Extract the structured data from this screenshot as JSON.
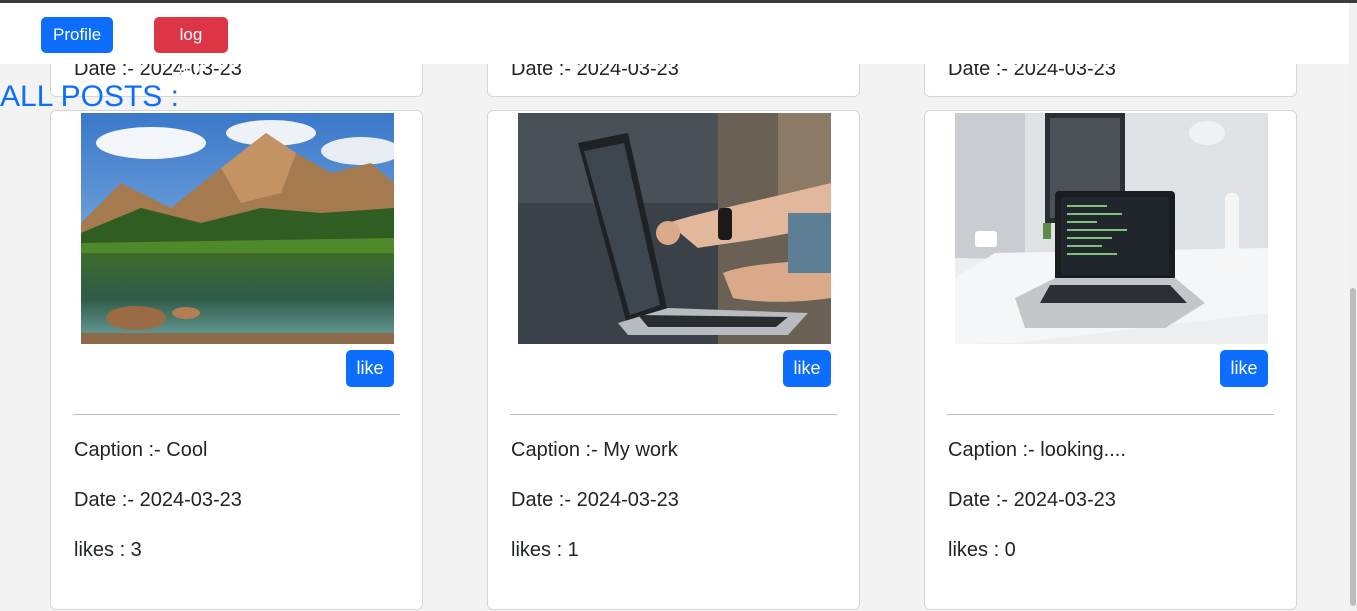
{
  "nav": {
    "profile_label": "Profile",
    "logout_label": "log out"
  },
  "section_title": "ALL POSTS :",
  "previous_row": [
    {
      "date": "Date :- 2024-03-23"
    },
    {
      "date": "Date :- 2024-03-23"
    },
    {
      "date": "Date :- 2024-03-23"
    }
  ],
  "posts": [
    {
      "image": "mountain-lake-photo",
      "like_label": "like",
      "caption": "Caption :- Cool",
      "date": "Date :- 2024-03-23",
      "likes": "likes : 3"
    },
    {
      "image": "laptop-pointing-photo",
      "like_label": "like",
      "caption": "Caption :- My work",
      "date": "Date :- 2024-03-23",
      "likes": "likes : 1"
    },
    {
      "image": "desk-laptop-photo",
      "like_label": "like",
      "caption": "Caption :- looking....",
      "date": "Date :- 2024-03-23",
      "likes": "likes : 0"
    }
  ],
  "colors": {
    "primary": "#0d6efd",
    "danger": "#dc3545",
    "page_bg": "#f3f3f3"
  }
}
